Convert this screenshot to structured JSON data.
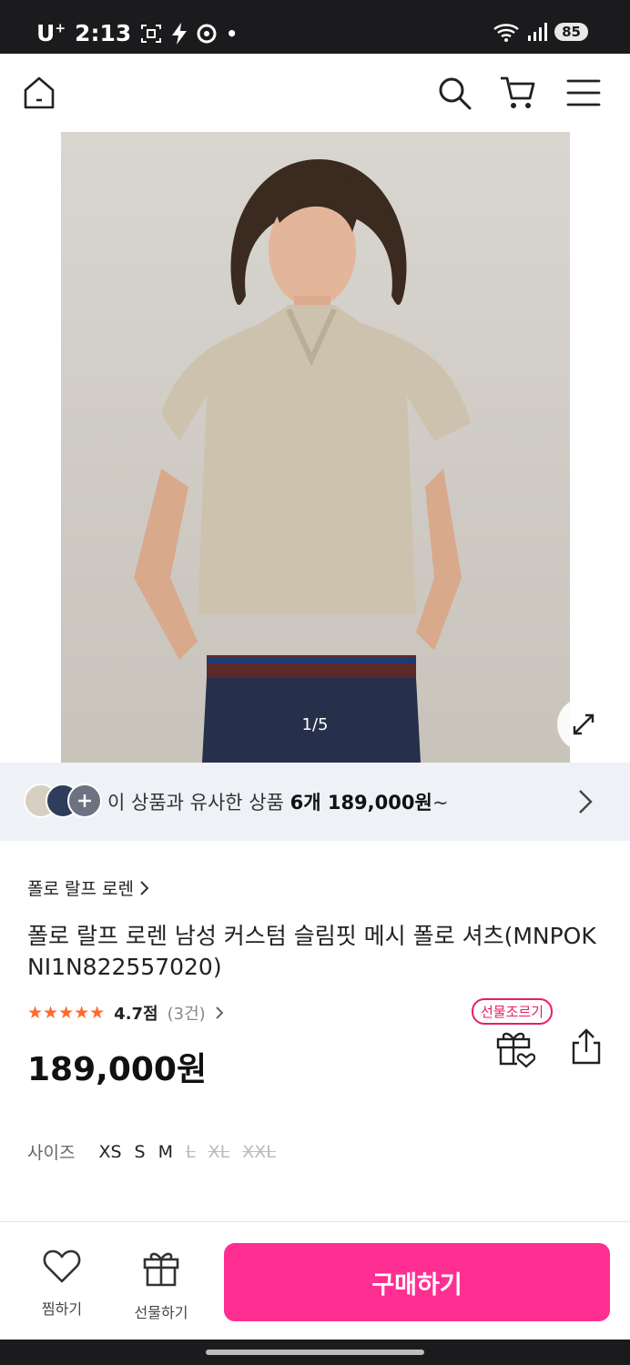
{
  "status_bar": {
    "carrier": "U",
    "carrier_sup": "+",
    "time": "2:13",
    "battery": "85"
  },
  "header": {
    "home_icon": "home-icon",
    "search_icon": "search-icon",
    "cart_icon": "cart-icon",
    "menu_icon": "menu-icon"
  },
  "hero": {
    "counter": "1/5",
    "expand_icon": "expand-icon"
  },
  "similar": {
    "text_prefix": "이 상품과 유사한 상품 ",
    "count": "6개 189,000원",
    "text_suffix": "~"
  },
  "product": {
    "brand": "폴로 랄프 로렌",
    "title": "폴로 랄프 로렌 남성 커스텀 슬림핏 메시 폴로 셔츠(MNPOKNI1N822557020)",
    "stars": "★★★★★",
    "score": "4.7점",
    "reviews": "(3건)",
    "price": "189,000원",
    "gift_badge": "선물조르기"
  },
  "sizes": {
    "label": "사이즈",
    "options": [
      "XS",
      "S",
      "M",
      "L",
      "XL",
      "XXL"
    ],
    "available": [
      true,
      true,
      true,
      false,
      false,
      false
    ]
  },
  "bottom_bar": {
    "wish_label": "찜하기",
    "gift_label": "선물하기",
    "buy_label": "구매하기"
  },
  "colors": {
    "accent": "#ff2e93",
    "star": "#ff6a2b",
    "status_bg": "#1b1b1d"
  }
}
